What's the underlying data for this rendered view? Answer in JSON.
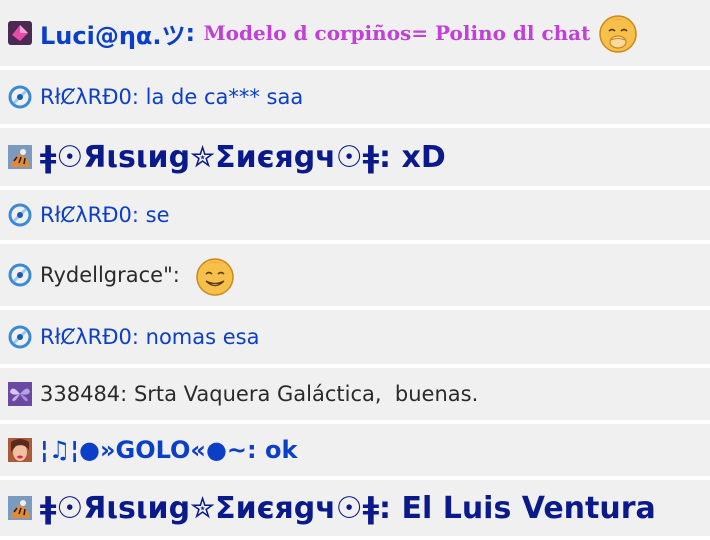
{
  "messages": [
    {
      "author": "Luci@ηα.ツ",
      "sep": ": ",
      "text": "Modelo d corpiños= Polino dl chat",
      "avatar": "pink-crystal-icon",
      "emoticon": "yawn-emoticon-icon"
    },
    {
      "author": "RłȻλRĐ0",
      "sep": ": ",
      "text": "la de ca*** saa",
      "avatar": "blue-ribbon-icon"
    },
    {
      "author": "ǂ☉Яιѕιиg✮Σиєяgч☉ǂ",
      "sep": ": ",
      "text": "xD",
      "avatar": "tiger-icon"
    },
    {
      "author": "RłȻλRĐ0",
      "sep": ": ",
      "text": "se",
      "avatar": "blue-ribbon-icon"
    },
    {
      "author": "Rydellgrace\"",
      "sep": ": ",
      "text": "",
      "avatar": "blue-ribbon-icon",
      "emoticon": "smile-emoticon-icon"
    },
    {
      "author": "RłȻλRĐ0",
      "sep": ": ",
      "text": "nomas esa",
      "avatar": "blue-ribbon-icon"
    },
    {
      "author": "338484",
      "sep": ": ",
      "text": "Srta Vaquera Galáctica,  buenas.",
      "avatar": "butterfly-icon"
    },
    {
      "author": "¦♫¦●»GOLO«●~",
      "sep": ": ",
      "text": "ok",
      "avatar": "face-photo-icon"
    },
    {
      "author": "ǂ☉Яιѕιиg✮Σиєяgч☉ǂ",
      "sep": ": ",
      "text": "El Luis Ventura",
      "avatar": "tiger-icon"
    }
  ],
  "colors": {
    "row_bg": "#f0f0f0",
    "blue_text": "#0b3fc8",
    "navy_text": "#0a1a8a",
    "pink_text": "#c040d8",
    "dark_text": "#2a2a2a"
  }
}
